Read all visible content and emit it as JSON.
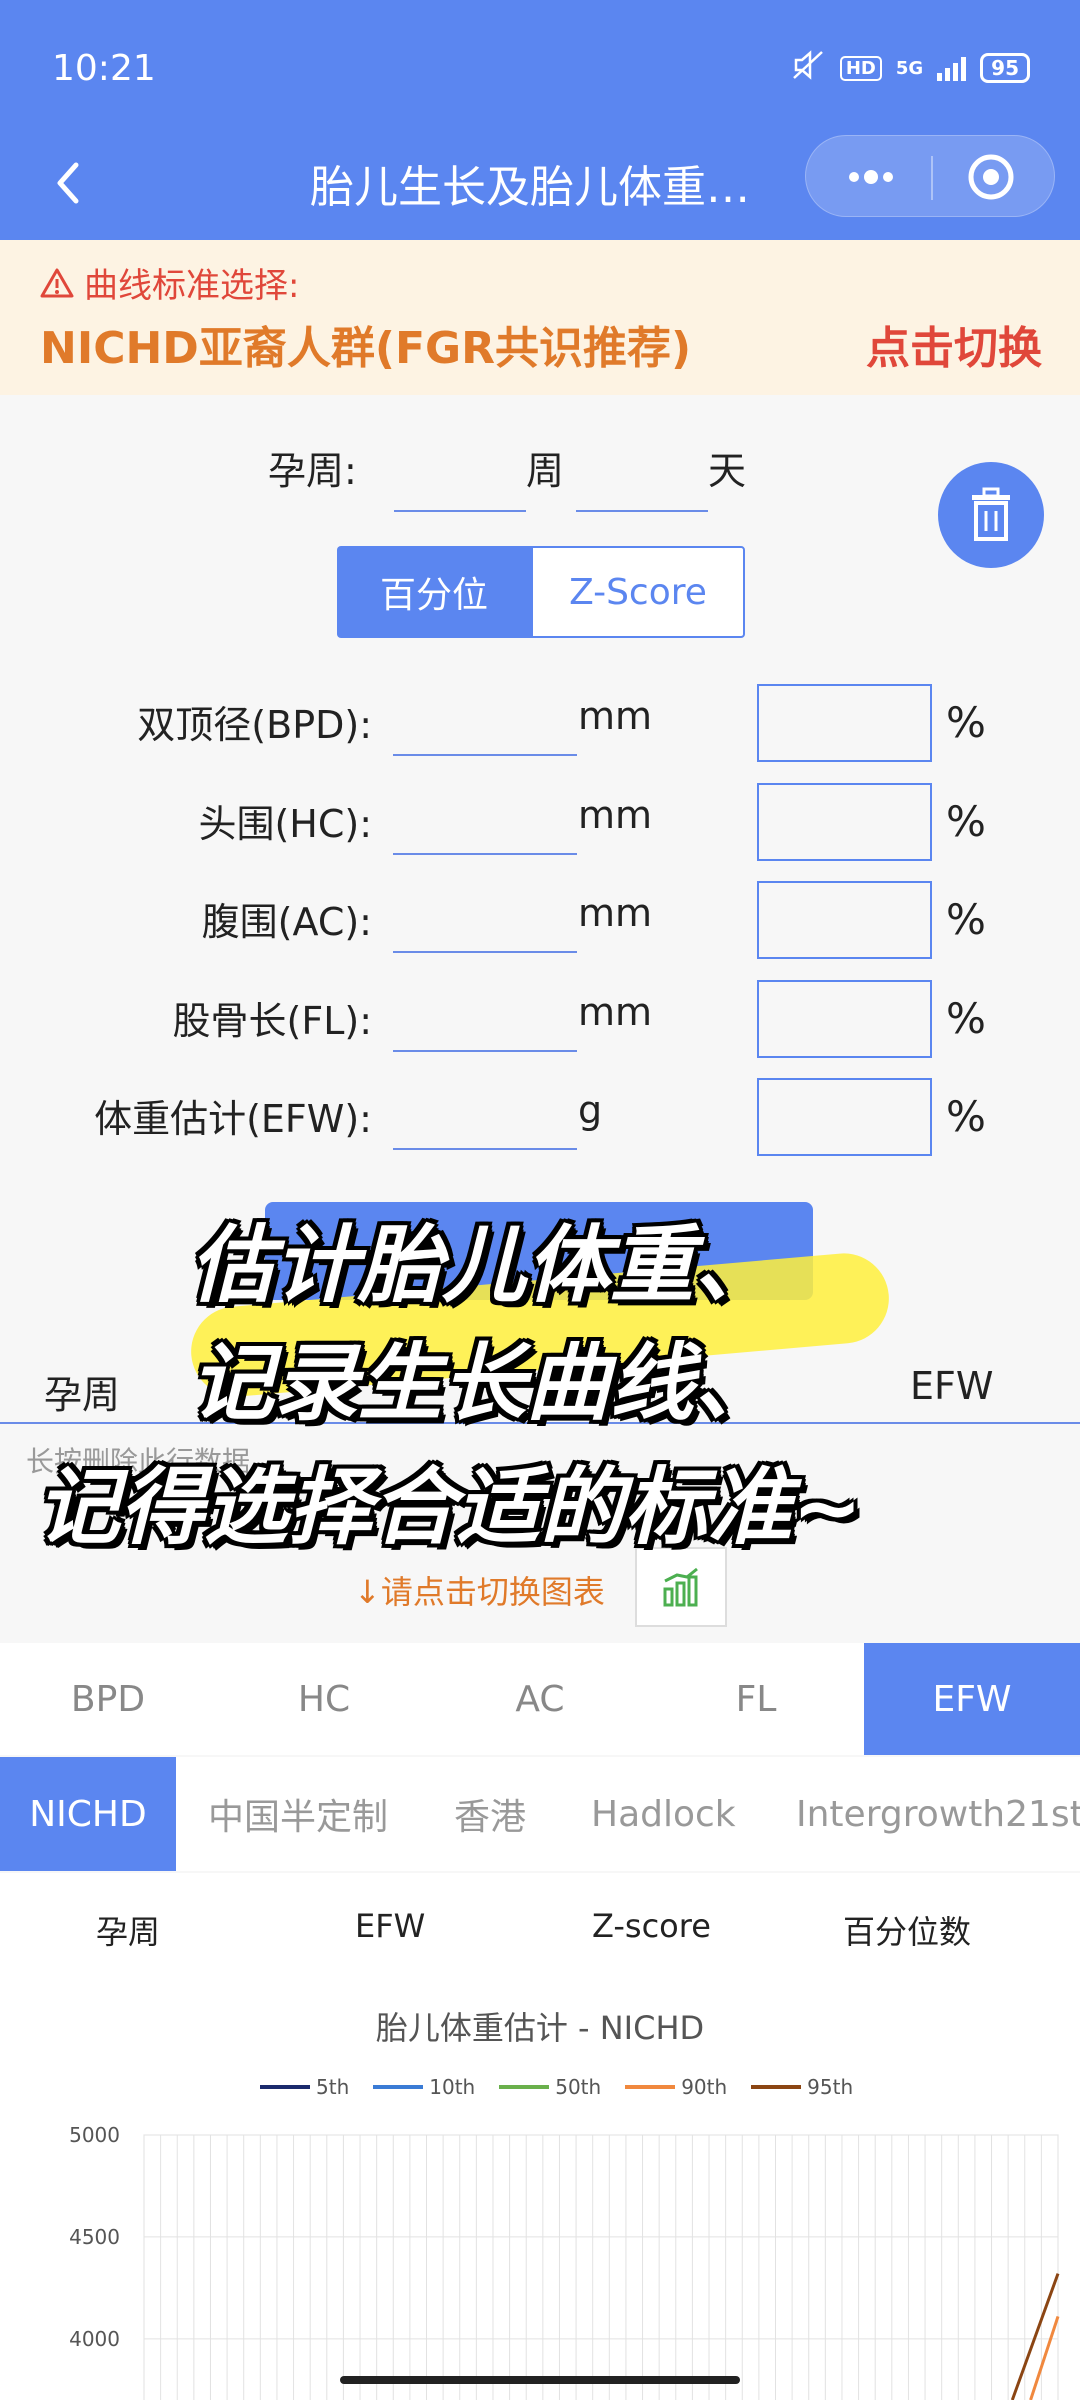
{
  "status": {
    "time": "10:21",
    "hd": "HD",
    "network": "5G",
    "battery": "95"
  },
  "nav": {
    "title": "胎儿生长及胎儿体重…"
  },
  "notice": {
    "label": "曲线标准选择:",
    "standard": "NICHD亚裔人群(FGR共识推荐)",
    "switch": "点击切换"
  },
  "form": {
    "ga_label": "孕周:",
    "week_unit": "周",
    "day_unit": "天",
    "mode_percentile": "百分位",
    "mode_zscore": "Z-Score",
    "rows": [
      {
        "label": "双顶径(BPD):",
        "unit": "mm",
        "pct": "%"
      },
      {
        "label": "头围(HC):",
        "unit": "mm",
        "pct": "%"
      },
      {
        "label": "腹围(AC):",
        "unit": "mm",
        "pct": "%"
      },
      {
        "label": "股骨长(FL):",
        "unit": "mm",
        "pct": "%"
      },
      {
        "label": "体重估计(EFW):",
        "unit": "g",
        "pct": "%"
      }
    ]
  },
  "table": {
    "col_ga": "孕周",
    "col_efw": "EFW",
    "hint": "长按删除此行数据"
  },
  "switch_hint": "↓请点击切换图表",
  "metric_tabs": [
    "BPD",
    "HC",
    "AC",
    "FL",
    "EFW"
  ],
  "standard_tabs": [
    "NICHD",
    "中国半定制",
    "香港",
    "Hadlock",
    "Intergrowth21st"
  ],
  "result_columns": [
    "孕周",
    "EFW",
    "Z-score",
    "百分位数"
  ],
  "overlay_caption": [
    "估计胎儿体重、",
    "记录生长曲线、",
    "记得选择合适的标准~"
  ],
  "colors": {
    "primary": "#5b86f0",
    "warning": "#e0473a",
    "orange": "#e07a2a"
  },
  "chart_data": {
    "type": "line",
    "title": "胎儿体重估计 - NICHD",
    "ylim": [
      3700,
      5000
    ],
    "yticks": [
      5000,
      4500,
      4000
    ],
    "grid": true,
    "legend_position": "top",
    "series": [
      {
        "name": "5th",
        "color": "#1a2a6c",
        "x": [],
        "y": []
      },
      {
        "name": "10th",
        "color": "#3a7bd5",
        "x": [],
        "y": []
      },
      {
        "name": "50th",
        "color": "#6ab04c",
        "x": [],
        "y": []
      },
      {
        "name": "90th",
        "color": "#f0883e",
        "x": [
          0.97,
          1.0
        ],
        "y": [
          3700,
          4110
        ]
      },
      {
        "name": "95th",
        "color": "#8b4513",
        "x": [
          0.95,
          1.0
        ],
        "y": [
          3700,
          4320
        ]
      }
    ]
  }
}
